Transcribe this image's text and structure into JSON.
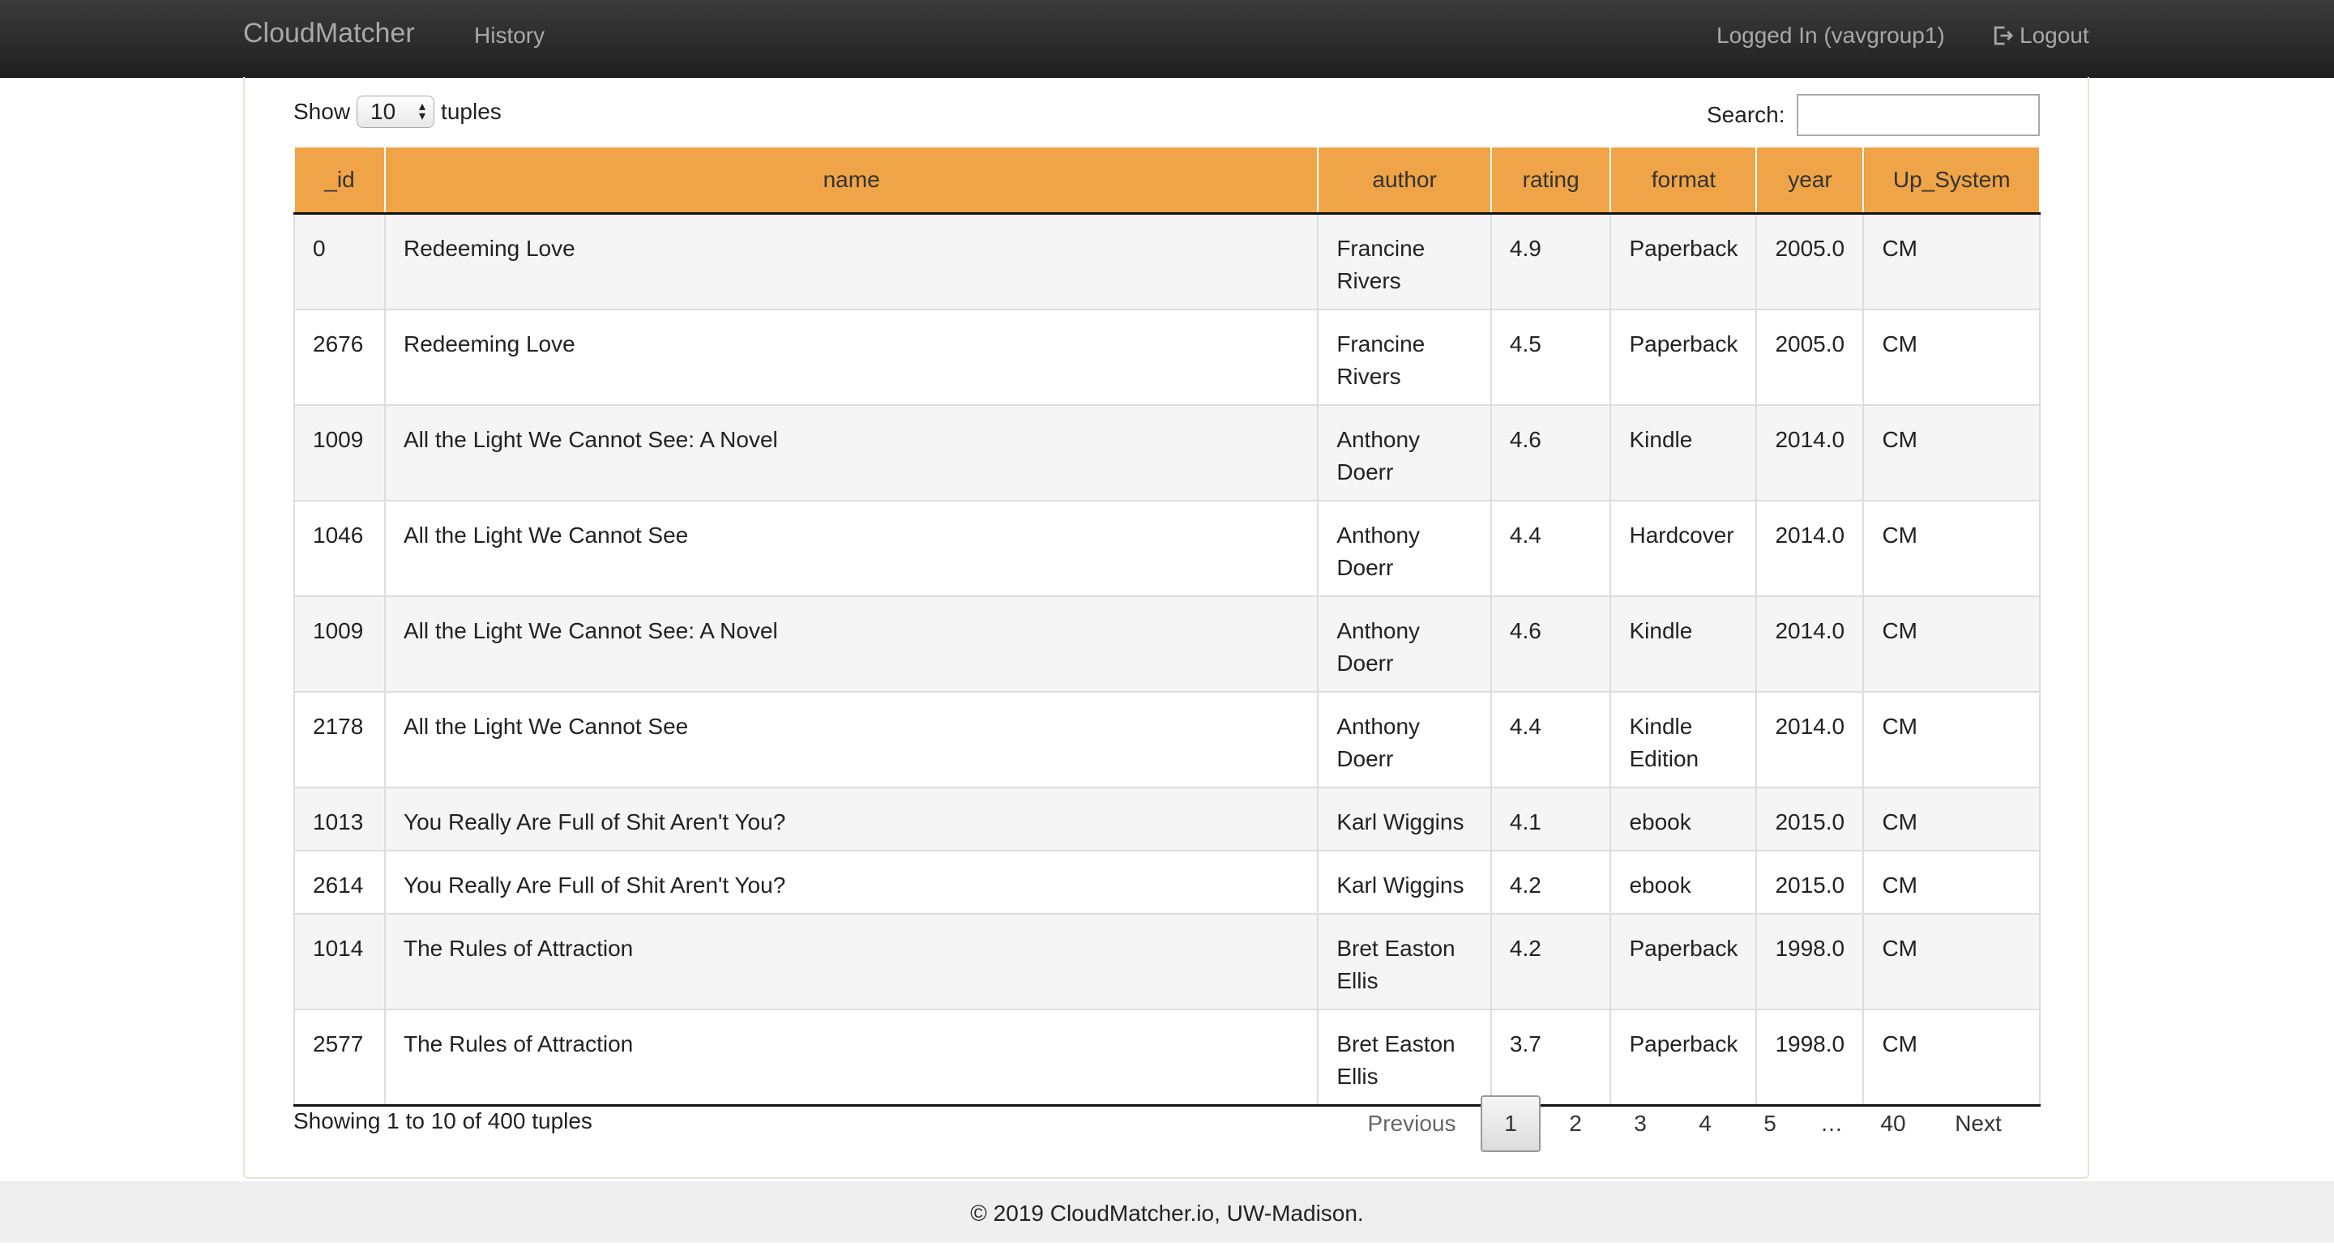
{
  "navbar": {
    "brand": "CloudMatcher",
    "history": "History",
    "user": "Logged In (vavgroup1)",
    "logout": "Logout"
  },
  "controls": {
    "show_label": "Show",
    "show_value": "10",
    "tuples_label": "tuples",
    "search_label": "Search:",
    "search_value": ""
  },
  "table": {
    "headers": [
      "_id",
      "name",
      "author",
      "rating",
      "format",
      "year",
      "Up_System"
    ],
    "rows": [
      {
        "id": "0",
        "name": "Redeeming Love",
        "author": "Francine Rivers",
        "rating": "4.9",
        "format": "Paperback",
        "year": "2005.0",
        "up": "CM"
      },
      {
        "id": "2676",
        "name": "Redeeming Love",
        "author": "Francine Rivers",
        "rating": "4.5",
        "format": "Paperback",
        "year": "2005.0",
        "up": "CM"
      },
      {
        "id": "1009",
        "name": "All the Light We Cannot See: A Novel",
        "author": "Anthony Doerr",
        "rating": "4.6",
        "format": "Kindle",
        "year": "2014.0",
        "up": "CM"
      },
      {
        "id": "1046",
        "name": "All the Light We Cannot See",
        "author": "Anthony Doerr",
        "rating": "4.4",
        "format": "Hardcover",
        "year": "2014.0",
        "up": "CM"
      },
      {
        "id": "1009",
        "name": "All the Light We Cannot See: A Novel",
        "author": "Anthony Doerr",
        "rating": "4.6",
        "format": "Kindle",
        "year": "2014.0",
        "up": "CM"
      },
      {
        "id": "2178",
        "name": "All the Light We Cannot See",
        "author": "Anthony Doerr",
        "rating": "4.4",
        "format": "Kindle Edition",
        "year": "2014.0",
        "up": "CM"
      },
      {
        "id": "1013",
        "name": "You Really Are Full of Shit Aren't You?",
        "author": "Karl Wiggins",
        "rating": "4.1",
        "format": "ebook",
        "year": "2015.0",
        "up": "CM"
      },
      {
        "id": "2614",
        "name": "You Really Are Full of Shit Aren't You?",
        "author": "Karl Wiggins",
        "rating": "4.2",
        "format": "ebook",
        "year": "2015.0",
        "up": "CM"
      },
      {
        "id": "1014",
        "name": "The Rules of Attraction",
        "author": "Bret Easton Ellis",
        "rating": "4.2",
        "format": "Paperback",
        "year": "1998.0",
        "up": "CM"
      },
      {
        "id": "2577",
        "name": "The Rules of Attraction",
        "author": "Bret Easton Ellis",
        "rating": "3.7",
        "format": "Paperback",
        "year": "1998.0",
        "up": "CM"
      }
    ]
  },
  "info": "Showing 1 to 10 of 400 tuples",
  "pagination": {
    "previous": "Previous",
    "pages": [
      "1",
      "2",
      "3",
      "4",
      "5"
    ],
    "current": "1",
    "ellipsis": "…",
    "last": "40",
    "next": "Next"
  },
  "footer": "© 2019 CloudMatcher.io, UW-Madison."
}
